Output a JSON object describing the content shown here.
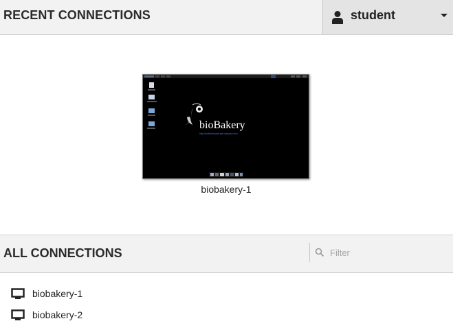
{
  "header": {
    "title": "RECENT CONNECTIONS",
    "user": {
      "name": "student",
      "icon": "user-icon"
    }
  },
  "recent": [
    {
      "label": "biobakery-1",
      "thumbnail": {
        "brand_text": "bioBakery",
        "url_text": "http://huttenhower.sph.harvard.edu"
      }
    }
  ],
  "all_connections": {
    "title": "ALL CONNECTIONS",
    "filter": {
      "placeholder": "Filter",
      "value": ""
    },
    "items": [
      {
        "label": "biobakery-1",
        "icon": "desktop-icon"
      },
      {
        "label": "biobakery-2",
        "icon": "desktop-icon"
      }
    ]
  },
  "colors": {
    "header_bg": "#f2f2f2",
    "user_menu_bg": "#e4e4e4",
    "thumbnail_bg": "#000000",
    "thumbnail_link": "#4a7bd8"
  }
}
